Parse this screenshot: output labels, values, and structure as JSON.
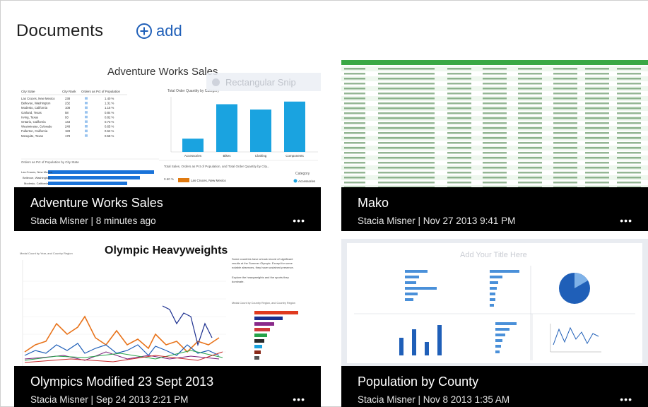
{
  "header": {
    "title": "Documents",
    "add_label": "add",
    "accent": "#1f5fb8"
  },
  "tiles": [
    {
      "title": "Adventure Works Sales",
      "meta": "Stacia Misner  |  8 minutes ago",
      "more": "•••",
      "thumb": {
        "heading": "Adventure Works Sales",
        "snip_overlay": "Rectangular Snip",
        "table_header": [
          "City State",
          "City Rank",
          "Orders as Pct of Population"
        ],
        "table_rows": [
          [
            "Las Cruces, New Mexico",
            "238",
            "1.40 %"
          ],
          [
            "Bellevue, Washington",
            "232",
            "1.31 %"
          ],
          [
            "Modesto, California",
            "108",
            "1.15 %"
          ],
          [
            "Garland, Texas",
            "58",
            "0.84 %"
          ],
          [
            "Irving, Texas",
            "93",
            "0.82 %"
          ],
          [
            "Ontario, California",
            "143",
            "0.73 %"
          ],
          [
            "Westminster, Colorado",
            "248",
            "0.65 %"
          ],
          [
            "Fullerton, California",
            "183",
            "0.62 %"
          ],
          [
            "Mesquite, Texas",
            "178",
            "0.58 %"
          ]
        ],
        "bar_chart_title": "Total Order Quantity by Category",
        "bar_categories": [
          "Accessories",
          "Bikes",
          "Clothing",
          "Components"
        ],
        "bar_values": [
          5,
          18,
          16,
          19
        ],
        "population_title": "Orders as Pct of Population by City State",
        "bottom_title": "Total Sales, Orders as Pct of Population, and Total Order Quantity by City...",
        "legend_label": "Category",
        "legend_item": "Accessories"
      }
    },
    {
      "title": "Mako",
      "meta": "Stacia Misner  |  Nov 27 2013 9:41 PM",
      "more": "•••"
    },
    {
      "title": "Olympics Modified 23 Sept 2013",
      "meta": "Stacia Misner  |  Sep 24 2013 2:21 PM",
      "more": "•••",
      "thumb": {
        "heading": "Olympic Heavyweights",
        "note": "Some countries have a track record of significant results at the Summer Olympic. Except for some notable absences, they have sustained presence.",
        "note2": "Explore the heavyweights and the sports they dominate."
      }
    },
    {
      "title": "Population by County",
      "meta": "Stacia Misner  |  Nov 8 2013 1:35 AM",
      "more": "•••",
      "thumb": {
        "heading": "Add Your Title Here"
      }
    }
  ]
}
